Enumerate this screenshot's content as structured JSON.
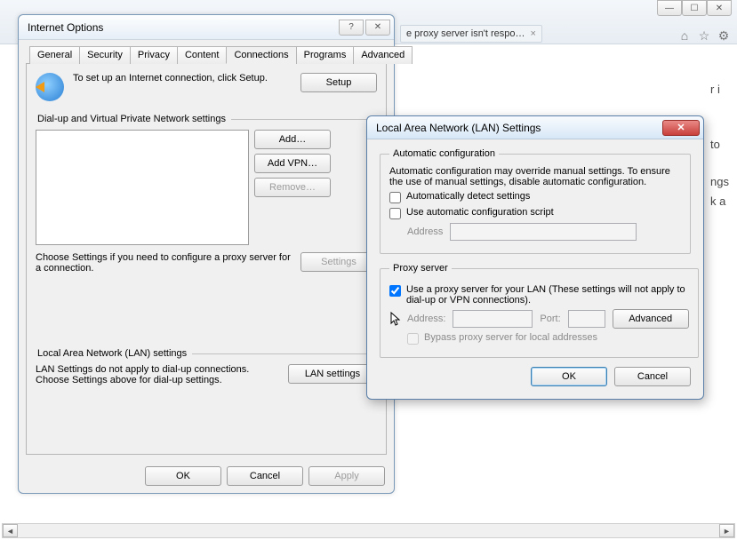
{
  "browser": {
    "tab_text": "e proxy server isn't respo…",
    "tab_close": "×",
    "icons": {
      "home": "⌂",
      "star": "☆",
      "gear": "⚙"
    },
    "win": {
      "min": "—",
      "max": "☐",
      "close": "✕"
    }
  },
  "bg_text": {
    "r1": "r i",
    "r2": "to",
    "r3": "ngs",
    "r4": "k a"
  },
  "io": {
    "title": "Internet Options",
    "title_btn_help": "?",
    "title_btn_close": "✕",
    "tabs": {
      "general": "General",
      "security": "Security",
      "privacy": "Privacy",
      "content": "Content",
      "connections": "Connections",
      "programs": "Programs",
      "advanced": "Advanced"
    },
    "setup_text": "To set up an Internet connection, click Setup.",
    "setup_btn": "Setup",
    "dialup_legend": "Dial-up and Virtual Private Network settings",
    "btn_add": "Add…",
    "btn_add_vpn": "Add VPN…",
    "btn_remove": "Remove…",
    "btn_settings": "Settings",
    "settings_desc": "Choose Settings if you need to configure a proxy server for a connection.",
    "lan_legend": "Local Area Network (LAN) settings",
    "lan_text": "LAN Settings do not apply to dial-up connections. Choose Settings above for dial-up settings.",
    "btn_lan_settings": "LAN settings",
    "btn_ok": "OK",
    "btn_cancel": "Cancel",
    "btn_apply": "Apply"
  },
  "lan": {
    "title": "Local Area Network (LAN) Settings",
    "close": "✕",
    "auto_legend": "Automatic configuration",
    "auto_desc": "Automatic configuration may override manual settings.  To ensure the use of manual settings, disable automatic configuration.",
    "chk_auto_detect": "Automatically detect settings",
    "chk_auto_script": "Use automatic configuration script",
    "address_label": "Address",
    "proxy_legend": "Proxy server",
    "chk_proxy": "Use a proxy server for your LAN (These settings will not apply to dial-up or VPN connections).",
    "addr_label": "Address:",
    "port_label": "Port:",
    "btn_advanced": "Advanced",
    "chk_bypass": "Bypass proxy server for local addresses",
    "btn_ok": "OK",
    "btn_cancel": "Cancel"
  }
}
